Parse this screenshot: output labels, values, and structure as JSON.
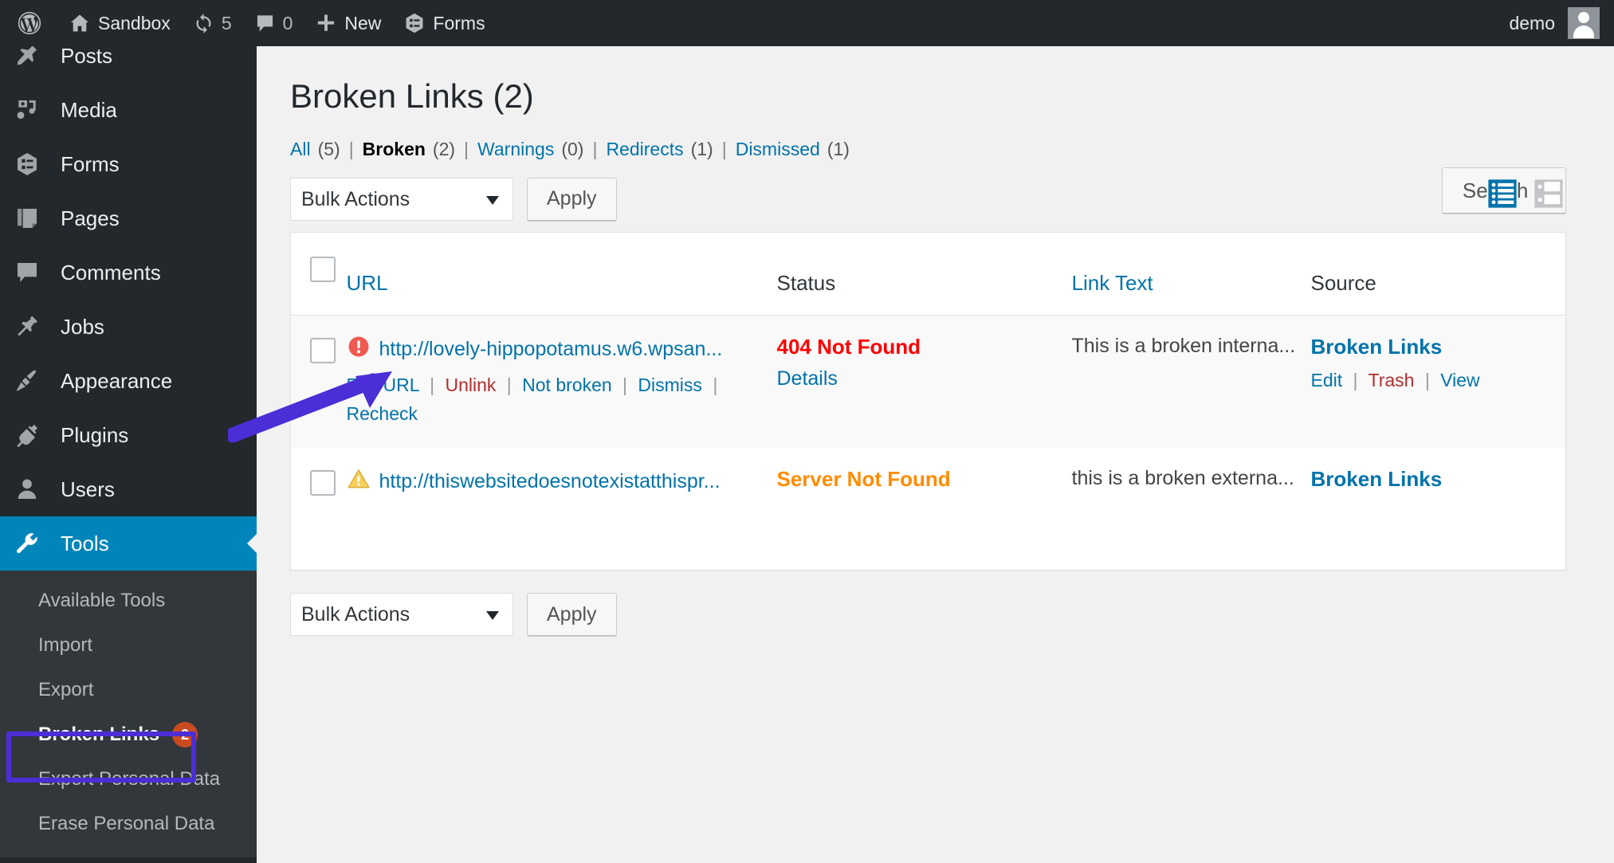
{
  "adminbar": {
    "logo_icon": "wordpress-logo-icon",
    "site": {
      "icon": "home-icon",
      "label": "Sandbox"
    },
    "updates": {
      "icon": "updates-icon",
      "count": "5"
    },
    "comments": {
      "icon": "comment-bubble-icon",
      "count": "0"
    },
    "new": {
      "icon": "plus-icon",
      "label": "New"
    },
    "forms": {
      "icon": "forms-icon",
      "label": "Forms"
    },
    "user": {
      "name": "demo",
      "avatar_icon": "avatar-icon"
    }
  },
  "sidebar": {
    "items": [
      {
        "label": "Posts",
        "icon": "pin-icon"
      },
      {
        "label": "Media",
        "icon": "media-icon"
      },
      {
        "label": "Forms",
        "icon": "forms-icon"
      },
      {
        "label": "Pages",
        "icon": "pages-icon"
      },
      {
        "label": "Comments",
        "icon": "comment-bubble-icon"
      },
      {
        "label": "Jobs",
        "icon": "pushpin-icon"
      },
      {
        "label": "Appearance",
        "icon": "paintbrush-icon"
      },
      {
        "label": "Plugins",
        "icon": "plug-icon"
      },
      {
        "label": "Users",
        "icon": "user-icon"
      },
      {
        "label": "Tools",
        "icon": "wrench-icon",
        "current": true
      }
    ],
    "submenu": [
      {
        "label": "Available Tools"
      },
      {
        "label": "Import"
      },
      {
        "label": "Export"
      },
      {
        "label": "Broken Links",
        "badge": "2",
        "current": true,
        "highlighted": true
      },
      {
        "label": "Export Personal Data"
      },
      {
        "label": "Erase Personal Data"
      }
    ]
  },
  "page": {
    "title": "Broken Links (2)",
    "search_button": "Search »"
  },
  "filters": [
    {
      "label": "All",
      "count": "(5)",
      "current": false
    },
    {
      "label": "Broken",
      "count": "(2)",
      "current": true
    },
    {
      "label": "Warnings",
      "count": "(0)",
      "current": false
    },
    {
      "label": "Redirects",
      "count": "(1)",
      "current": false
    },
    {
      "label": "Dismissed",
      "count": "(1)",
      "current": false
    }
  ],
  "tablenav": {
    "bulk_selected": "Bulk Actions",
    "bulk_options": [
      "Bulk Actions"
    ],
    "apply_label": "Apply",
    "view_list_icon": "list-view-icon",
    "view_excerpt_icon": "excerpt-view-icon",
    "list_view_active_color": "#0073aa",
    "excerpt_view_color": "#c3c4c7"
  },
  "table": {
    "columns": [
      {
        "key": "cb",
        "label": "",
        "link": false
      },
      {
        "key": "url",
        "label": "URL",
        "link": true
      },
      {
        "key": "status",
        "label": "Status",
        "link": false
      },
      {
        "key": "linktext",
        "label": "Link Text",
        "link": true
      },
      {
        "key": "source",
        "label": "Source",
        "link": false
      }
    ],
    "rows": [
      {
        "icon": "error-icon",
        "icon_color": "#ee5a52",
        "url": "http://lovely-hippopotamus.w6.wpsan...",
        "actions": [
          {
            "label": "Edit URL",
            "style": "link"
          },
          {
            "label": "Unlink",
            "style": "delete"
          },
          {
            "label": "Not broken",
            "style": "link"
          },
          {
            "label": "Dismiss",
            "style": "link"
          },
          {
            "label": "Recheck",
            "style": "link"
          }
        ],
        "status": "404 Not Found",
        "status_style": "error",
        "status_detail": "Details",
        "link_text": "This is a broken interna...",
        "source": "Broken Links",
        "source_actions": [
          {
            "label": "Edit",
            "style": "link"
          },
          {
            "label": "Trash",
            "style": "delete"
          },
          {
            "label": "View",
            "style": "link"
          }
        ]
      },
      {
        "icon": "warning-icon",
        "icon_color": "#f0c040",
        "url": "http://thiswebsitedoesnotexistatthispr...",
        "actions": [],
        "status": "Server Not Found",
        "status_style": "warning",
        "status_detail": "",
        "link_text": "this is a broken externa...",
        "source": "Broken Links",
        "source_actions": []
      }
    ]
  },
  "annotations": {
    "arrow_color": "#4b2ed6",
    "highlight_color": "#4b2ed6"
  },
  "colors": {
    "admin_bg": "#23282d",
    "current_menu": "#0085ba",
    "badge": "#ca4a1f",
    "link": "#0073aa",
    "error": "#ff0000",
    "warning": "#ff8c00"
  }
}
